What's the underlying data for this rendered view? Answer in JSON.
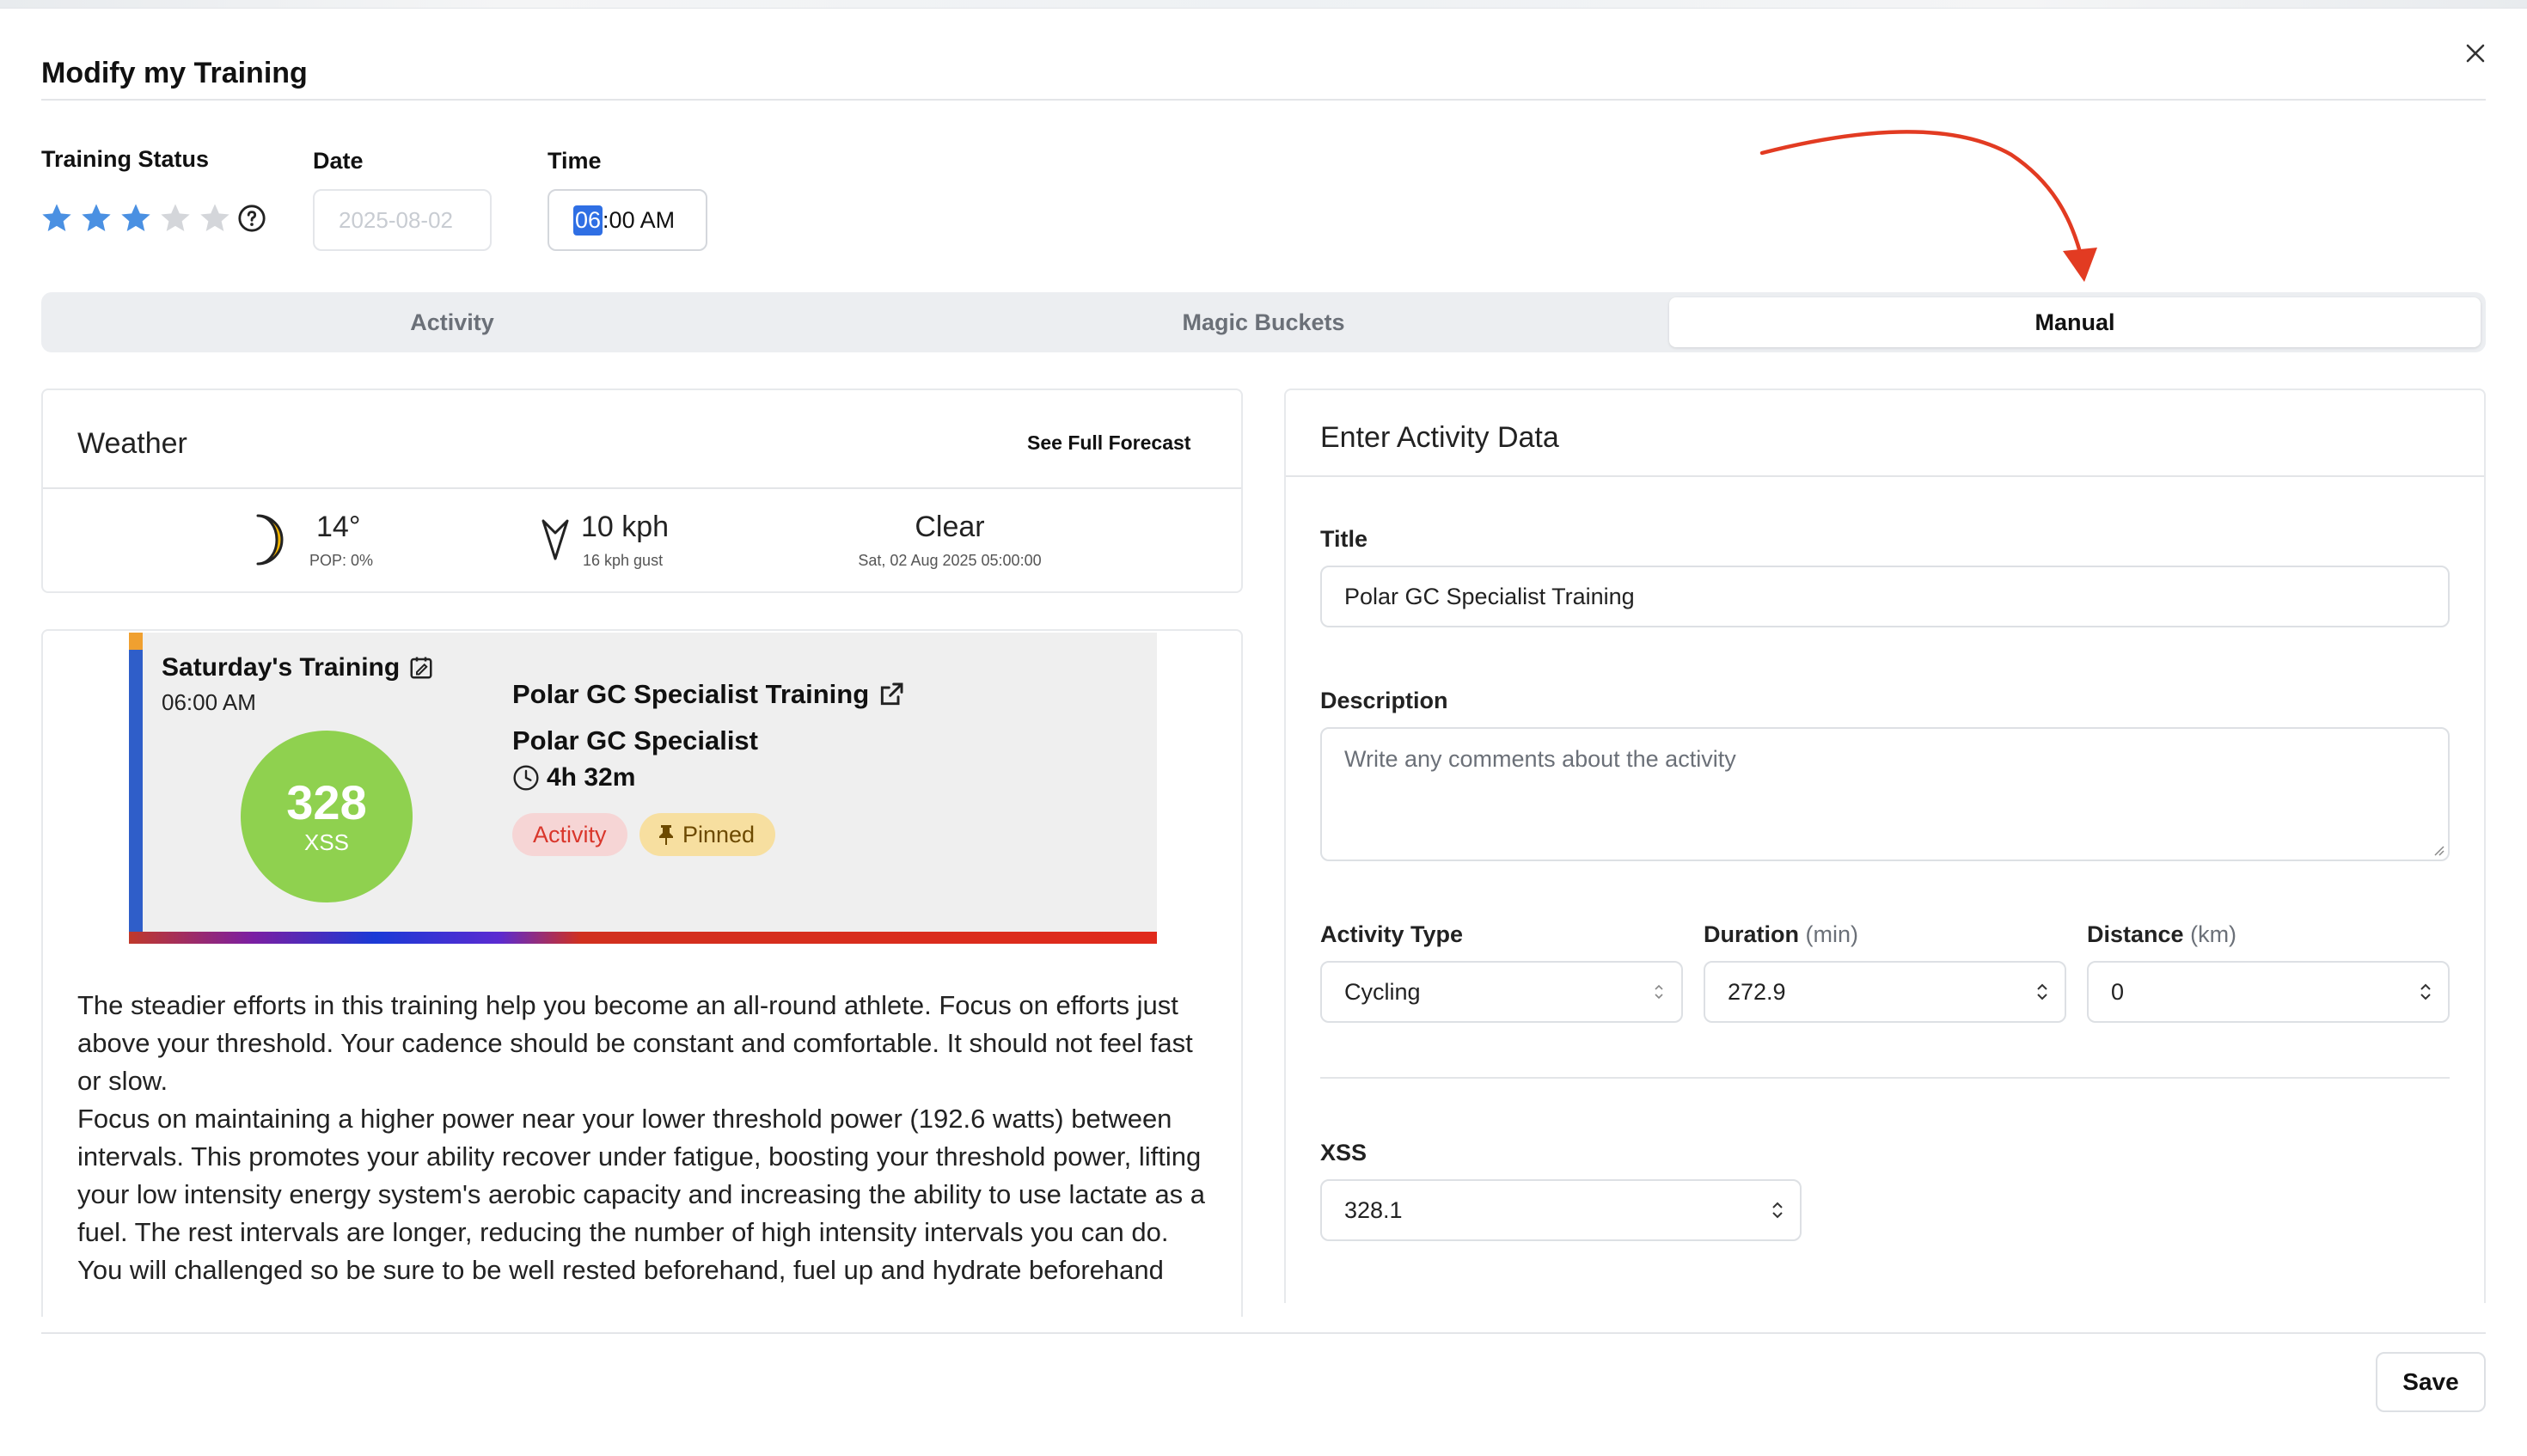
{
  "modal": {
    "title": "Modify my Training"
  },
  "status": {
    "label": "Training Status",
    "rating": 3,
    "max": 5,
    "help_icon": "question-circle-icon"
  },
  "date": {
    "label": "Date",
    "value": "2025-08-02"
  },
  "time": {
    "label": "Time",
    "hour": "06",
    "rest": ":00 AM"
  },
  "tabs": [
    {
      "label": "Activity"
    },
    {
      "label": "Magic Buckets"
    },
    {
      "label": "Manual"
    }
  ],
  "active_tab": "Manual",
  "weather": {
    "title": "Weather",
    "link": "See Full Forecast",
    "temp": "14°",
    "pop": "POP: 0%",
    "wind": "10 kph",
    "gust": "16 kph gust",
    "condition": "Clear",
    "datetime": "Sat, 02 Aug 2025 05:00:00"
  },
  "training": {
    "day_title": "Saturday's Training",
    "time": "06:00 AM",
    "xss_value": "328",
    "xss_label": "XSS",
    "workout_title": "Polar GC Specialist Training",
    "workout_name": "Polar GC Specialist",
    "duration": "4h 32m",
    "badge_activity": "Activity",
    "badge_pinned": "Pinned",
    "description_lines": [
      "The steadier efforts in this training help you become an all-round athlete. Focus on efforts just above your threshold. Your cadence should be constant and comfortable. It should not feel fast or slow.",
      "Focus on maintaining a higher power near your lower threshold power (192.6 watts) between intervals. This promotes your ability recover under fatigue, boosting your threshold power, lifting your low intensity energy system's aerobic capacity and increasing the ability to use lactate as a fuel. The rest intervals are longer, reducing the number of high intensity intervals you can do.",
      "You will challenged so be sure to be well rested beforehand, fuel up and hydrate beforehand"
    ]
  },
  "form": {
    "title": "Enter Activity Data",
    "title_label": "Title",
    "title_value": "Polar GC Specialist Training",
    "description_label": "Description",
    "description_placeholder": "Write any comments about the activity",
    "activity_type_label": "Activity Type",
    "activity_type_value": "Cycling",
    "duration_label": "Duration",
    "duration_unit": "(min)",
    "duration_value": "272.9",
    "distance_label": "Distance",
    "distance_unit": "(km)",
    "distance_value": "0",
    "xss_label": "XSS",
    "xss_value": "328.1"
  },
  "footer": {
    "save_label": "Save"
  },
  "colors": {
    "accent_blue": "#2f6fe4",
    "star": "#4a90e2",
    "xss_circle": "#8fd14f",
    "badge_activity_bg": "#f6d5d5",
    "badge_pinned_bg": "#f7dfa0",
    "annotation_arrow": "#e23b22"
  }
}
